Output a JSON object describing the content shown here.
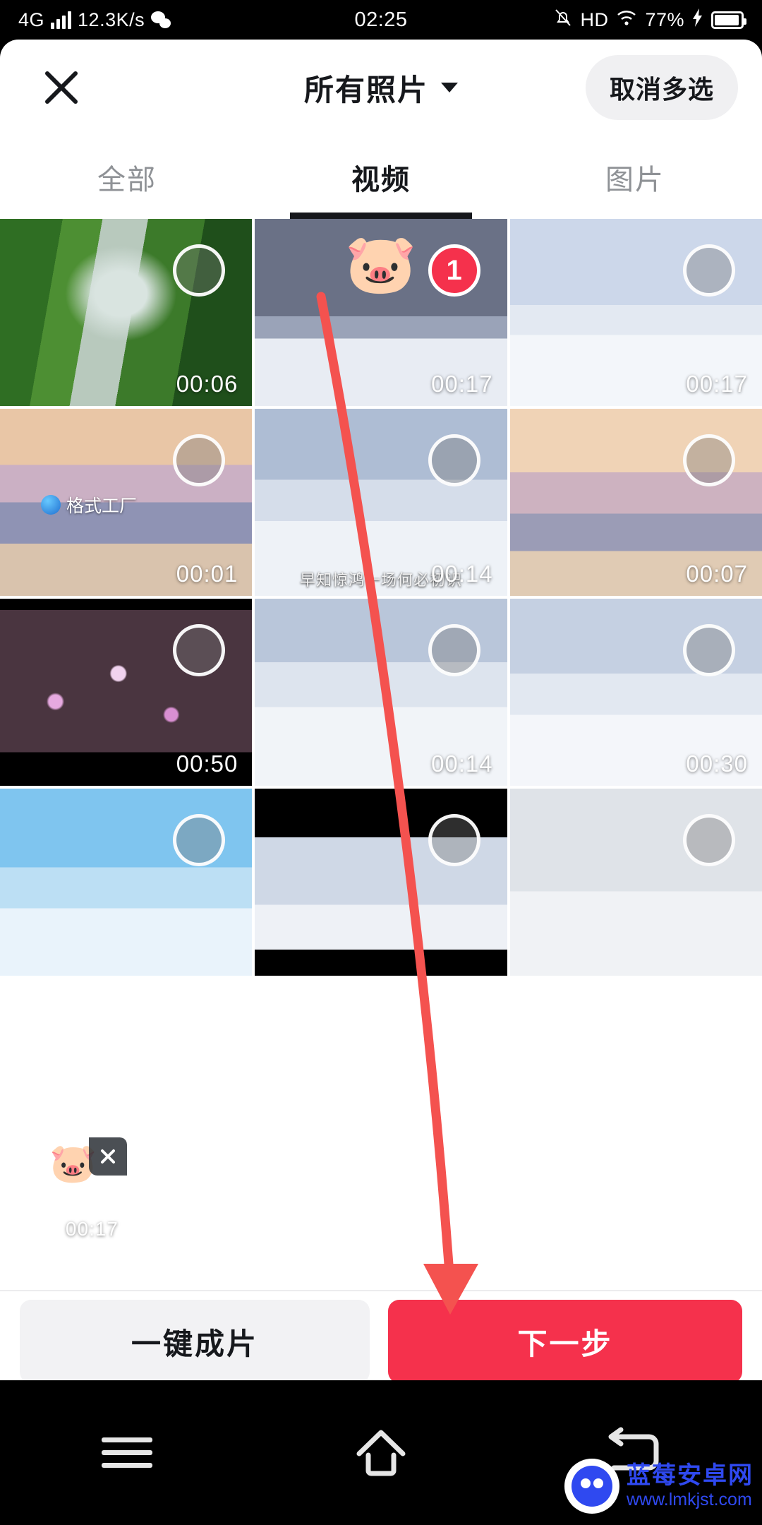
{
  "status_bar": {
    "network": "4G",
    "speed": "12.3K/s",
    "app_icon": "wechat-icon",
    "time": "02:25",
    "mute_icon": "bell-muted-icon",
    "hd": "HD",
    "wifi_icon": "wifi-icon",
    "battery_percent": "77%",
    "charging_icon": "bolt-icon"
  },
  "header": {
    "close_icon": "close-icon",
    "title": "所有照片",
    "caret_icon": "chevron-down-icon",
    "multi_select_label": "取消多选"
  },
  "tabs": [
    {
      "label": "全部",
      "active": false
    },
    {
      "label": "视频",
      "active": true
    },
    {
      "label": "图片",
      "active": false
    }
  ],
  "grid": {
    "items": [
      {
        "art": "art-waterfall",
        "duration": "00:06",
        "selected": false,
        "badge": "",
        "overlay": ""
      },
      {
        "art": "art-snowrail",
        "duration": "00:17",
        "selected": true,
        "badge": "1",
        "overlay": "pig-sticker"
      },
      {
        "art": "art-snowrail2",
        "duration": "00:17",
        "selected": false,
        "badge": "",
        "overlay": ""
      },
      {
        "art": "art-sunset",
        "duration": "00:01",
        "selected": false,
        "badge": "",
        "overlay": "format-factory-watermark",
        "watermark": "格式工厂"
      },
      {
        "art": "art-snowtree",
        "duration": "00:14",
        "selected": false,
        "badge": "",
        "overlay": "subtitle",
        "subtitle": "早知惊鸿一场何必初识"
      },
      {
        "art": "art-sunset2",
        "duration": "00:07",
        "selected": false,
        "badge": "",
        "overlay": ""
      },
      {
        "art": "art-blossom",
        "duration": "00:50",
        "selected": false,
        "badge": "",
        "overlay": ""
      },
      {
        "art": "art-snowpath",
        "duration": "00:14",
        "selected": false,
        "badge": "",
        "overlay": ""
      },
      {
        "art": "art-snowrail3",
        "duration": "00:30",
        "selected": false,
        "badge": "",
        "overlay": ""
      },
      {
        "art": "art-birds",
        "duration": "",
        "selected": false,
        "badge": "",
        "overlay": ""
      },
      {
        "art": "art-letterbox",
        "duration": "",
        "selected": false,
        "badge": "",
        "overlay": ""
      },
      {
        "art": "art-cloud",
        "duration": "",
        "selected": false,
        "badge": "",
        "overlay": ""
      }
    ]
  },
  "tray": {
    "items": [
      {
        "art": "art-snowrail",
        "duration": "00:17",
        "remove_icon": "close-icon",
        "overlay": "pig-sticker"
      }
    ]
  },
  "actions": {
    "secondary_label": "一键成片",
    "primary_label": "下一步"
  },
  "navbar": {
    "items": [
      {
        "icon": "menu-icon"
      },
      {
        "icon": "home-icon"
      },
      {
        "icon": "back-icon"
      }
    ]
  },
  "annotation": {
    "type": "red-arrow",
    "color": "#f4524f",
    "from_label": "视频选中项",
    "to_label": "下一步"
  },
  "site_watermark": {
    "name": "蓝莓安卓网",
    "url": "www.lmkjst.com",
    "color": "#2f49f0"
  },
  "colors": {
    "accent": "#f5314c",
    "text_primary": "#16181c",
    "text_muted": "#8f9296",
    "chip_bg": "#f0f0f2"
  }
}
